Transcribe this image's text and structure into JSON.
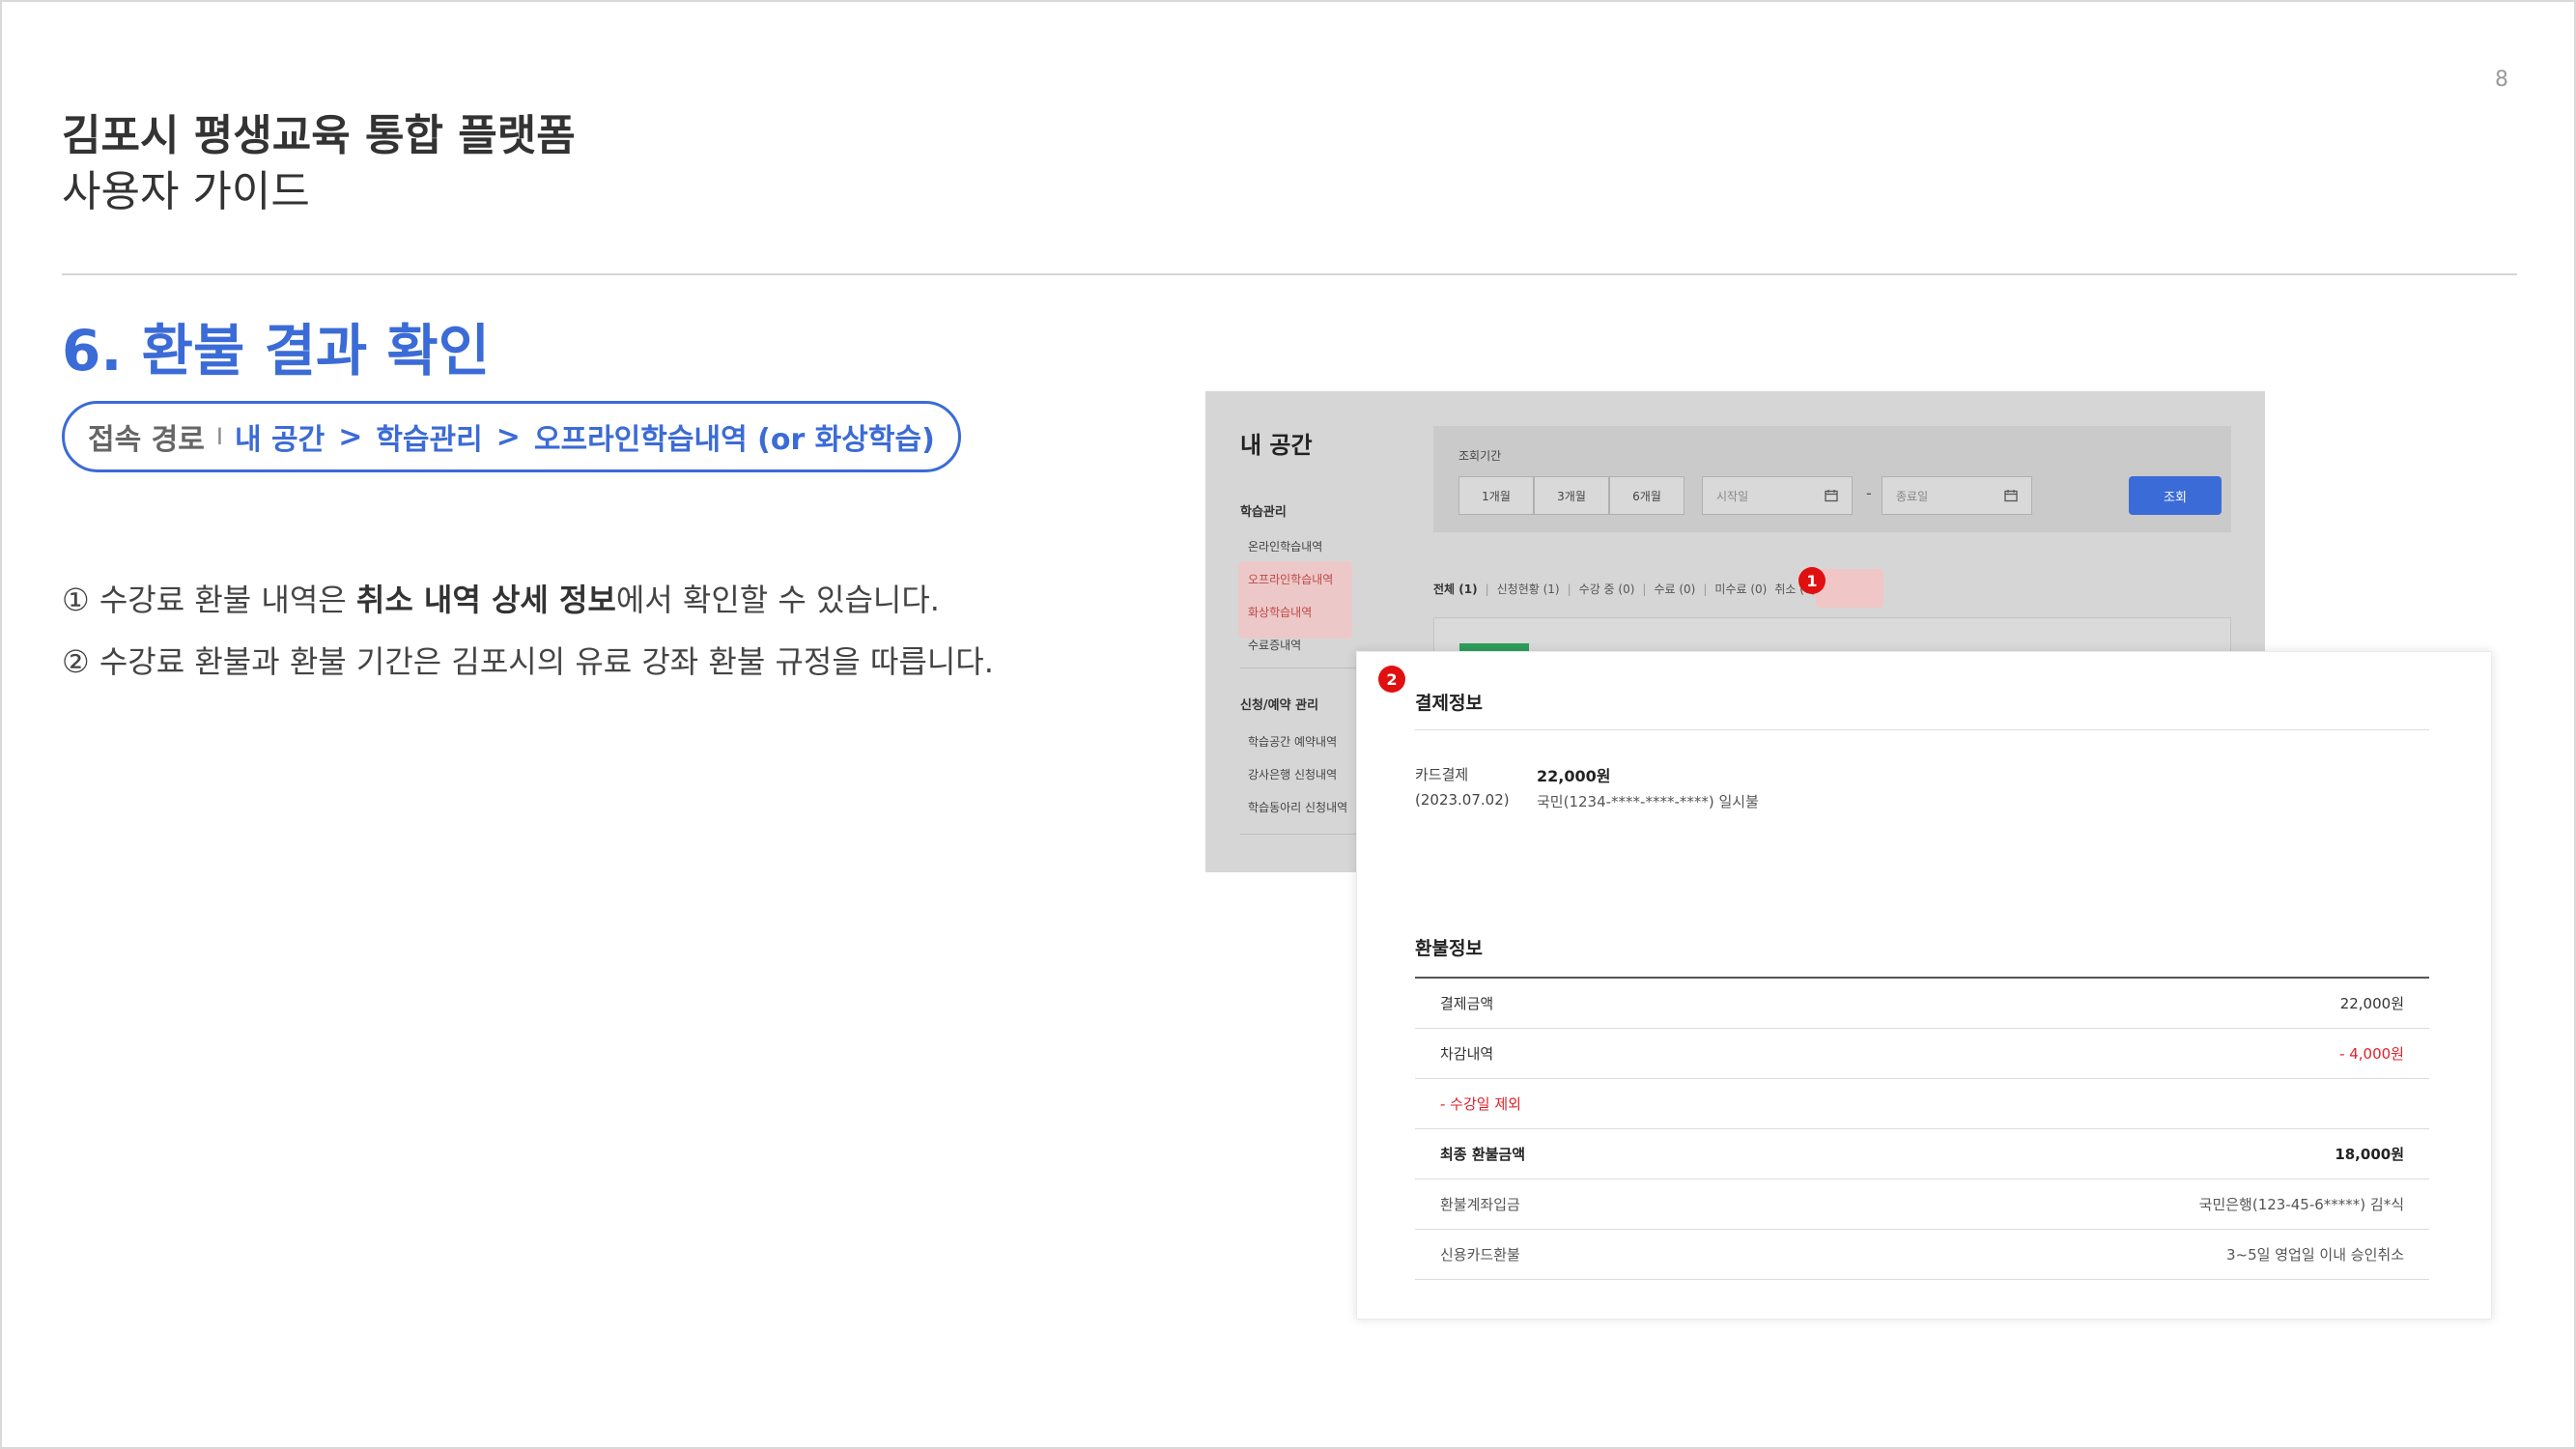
{
  "page_number": "8",
  "header": {
    "title": "김포시 평생교육 통합 플랫폼",
    "subtitle": "사용자 가이드"
  },
  "section_title": "6. 환불 결과 확인",
  "access_path": {
    "label": "접속 경로",
    "separator": "I",
    "steps": [
      "내 공간",
      "학습관리",
      "오프라인학습내역 (or 화상학습)"
    ],
    "arrow": ">"
  },
  "notes": {
    "n1_prefix": "① 수강료 환불 내역은 ",
    "n1_bold": "취소 내역 상세 정보",
    "n1_suffix": "에서 확인할 수 있습니다.",
    "n2": "② 수강료 환불과 환불 기간은 김포시의 유료 강좌 환불 규정을 따릅니다."
  },
  "screenshot": {
    "title": "내 공간",
    "sidebar": {
      "group1": "학습관리",
      "group1_items": [
        "온라인학습내역",
        "오프라인학습내역",
        "화상학습내역",
        "수료증내역"
      ],
      "group2": "신청/예약 관리",
      "group2_items": [
        "학습공간 예약내역",
        "강사은행 신청내역",
        "학습동아리 신청내역"
      ]
    },
    "filter": {
      "label": "조회기간",
      "periods": [
        "1개월",
        "3개월",
        "6개월"
      ],
      "start_placeholder": "시작일",
      "end_placeholder": "종료일",
      "dash": "-",
      "search_button": "조회"
    },
    "tabs": [
      "전체 (1)",
      "신청현황 (1)",
      "수강 중 (0)",
      "수료 (0)",
      "미수료 (0)",
      "취소 (0)"
    ],
    "tab_separator": "|",
    "badges": [
      "1",
      "2"
    ]
  },
  "payment_info": {
    "heading": "결제정보",
    "method": "카드결제",
    "date": "(2023.07.02)",
    "amount": "22,000원",
    "card": "국민(1234-****-****-****) 일시불"
  },
  "refund_info": {
    "heading": "환불정보",
    "rows": [
      {
        "label": "결제금액",
        "value": "22,000원"
      },
      {
        "label": "차감내역",
        "value": "- 4,000원"
      },
      {
        "label": "- 수강일 제외",
        "value": ""
      },
      {
        "label": "최종 환불금액",
        "value": "18,000원"
      },
      {
        "label": "환불계좌입금",
        "value": "국민은행(123-45-6*****) 김*식"
      },
      {
        "label": "신용카드환불",
        "value": "3~5일 영업일 이내 승인취소"
      }
    ]
  },
  "colors": {
    "accent": "#3b6bd6",
    "highlight": "#f0c6c6",
    "badge": "#e01010",
    "deduction": "#e0202a"
  }
}
